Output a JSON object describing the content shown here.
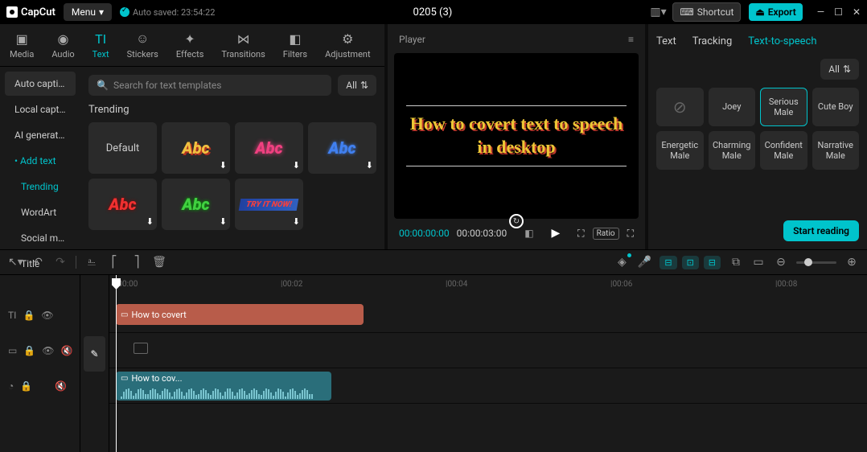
{
  "titlebar": {
    "logo": "CapCut",
    "menu": "Menu",
    "autosave": "Auto saved: 23:54:22",
    "project": "0205 (3)",
    "shortcut": "Shortcut",
    "export": "Export"
  },
  "assets": {
    "tabs": [
      {
        "label": "Media",
        "icon": "▣"
      },
      {
        "label": "Audio",
        "icon": "◉"
      },
      {
        "label": "Text",
        "icon": "TI"
      },
      {
        "label": "Stickers",
        "icon": "☺"
      },
      {
        "label": "Effects",
        "icon": "✦"
      },
      {
        "label": "Transitions",
        "icon": "⋈"
      },
      {
        "label": "Filters",
        "icon": "◧"
      },
      {
        "label": "Adjustment",
        "icon": "⚙"
      }
    ],
    "active_tab": "Text"
  },
  "sidebar": {
    "items": [
      {
        "label": "Auto captio...",
        "selected": true
      },
      {
        "label": "Local capti..."
      },
      {
        "label": "AI generated"
      },
      {
        "label": "Add text",
        "highlight": true,
        "bullet": true
      },
      {
        "label": "Trending",
        "highlight": true,
        "sub": true
      },
      {
        "label": "WordArt",
        "sub": true
      },
      {
        "label": "Social media",
        "sub": true
      },
      {
        "label": "Title",
        "sub": true
      }
    ]
  },
  "content": {
    "search_placeholder": "Search for text templates",
    "filter": "All",
    "section": "Trending",
    "templates": [
      {
        "label": "Default",
        "style": "color:#ccc;font-size:13px;font-weight:400;font-style:normal"
      },
      {
        "label": "Abc",
        "style": "color:#f0c040;text-shadow:2px 2px 0 #b03020"
      },
      {
        "label": "Abc",
        "style": "color:#f04080;text-shadow:0 0 6px #f04080"
      },
      {
        "label": "Abc",
        "style": "color:#4080f0;text-shadow:0 0 4px #4080f0"
      },
      {
        "label": "Abc",
        "style": "color:#f03030;text-shadow:0 0 4px #800"
      },
      {
        "label": "Abc",
        "style": "color:#40d040;text-shadow:0 0 4px #0a0"
      },
      {
        "label": "TRY IT NOW!",
        "style": "color:#f04040;font-size:10px;background:linear-gradient(90deg,#2040a0,#3060c0);padding:2px 8px;transform:skewX(-10deg)"
      }
    ]
  },
  "player": {
    "title": "Player",
    "preview_text": "How to covert text to speech in desktop",
    "current_time": "00:00:00:00",
    "duration": "00:00:03:00",
    "ratio": "Ratio"
  },
  "rightpanel": {
    "tabs": [
      "Text",
      "Tracking",
      "Text-to-speech"
    ],
    "active": "Text-to-speech",
    "filter": "All",
    "voices": [
      {
        "label": "⊘",
        "none": true
      },
      {
        "label": "Joey"
      },
      {
        "label": "Serious Male",
        "selected": true
      },
      {
        "label": "Cute Boy"
      },
      {
        "label": "Energetic Male"
      },
      {
        "label": "Charming Male"
      },
      {
        "label": "Confident Male"
      },
      {
        "label": "Narrative Male"
      }
    ],
    "start_reading": "Start reading"
  },
  "timeline": {
    "ruler": [
      "|00:00",
      "|00:02",
      "|00:04",
      "|00:06",
      "|00:08"
    ],
    "text_clip": "How to covert",
    "audio_clip": "How to cov..."
  }
}
